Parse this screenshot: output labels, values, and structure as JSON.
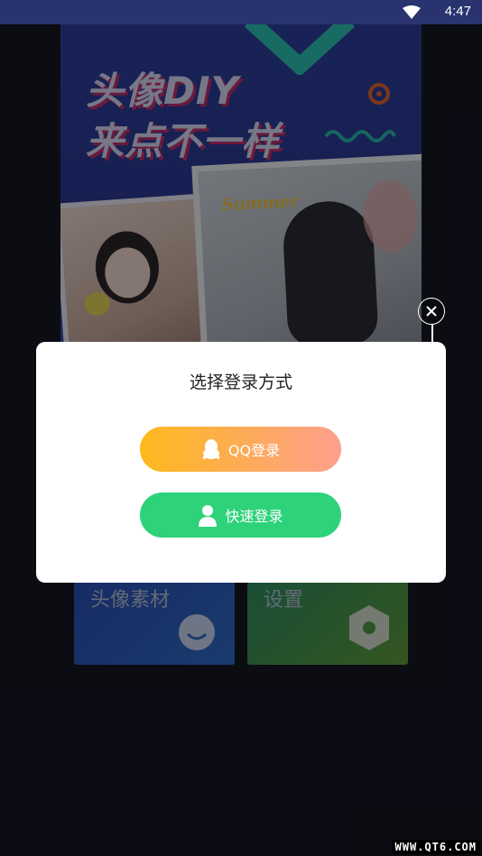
{
  "status_bar": {
    "time": "4:47",
    "wifi_icon": "wifi-icon"
  },
  "banner": {
    "title_line1": "头像DIY",
    "title_line2": "来点不一样",
    "sticker_text": "Summer"
  },
  "tiles": [
    {
      "label": "头像素材",
      "icon": "face-icon",
      "color": "#2f6cc7"
    },
    {
      "label": "设置",
      "icon": "hexagon-settings-icon",
      "color": "#4f9a45"
    }
  ],
  "dialog": {
    "title": "选择登录方式",
    "qq_login_label": "QQ登录",
    "quick_login_label": "快速登录",
    "close_icon": "close-icon"
  },
  "colors": {
    "qq_gradient_start": "#fdb91d",
    "qq_gradient_end": "#fd9f8d",
    "quick_button": "#2dd27a"
  },
  "watermark": "WWW.QT6.COM"
}
